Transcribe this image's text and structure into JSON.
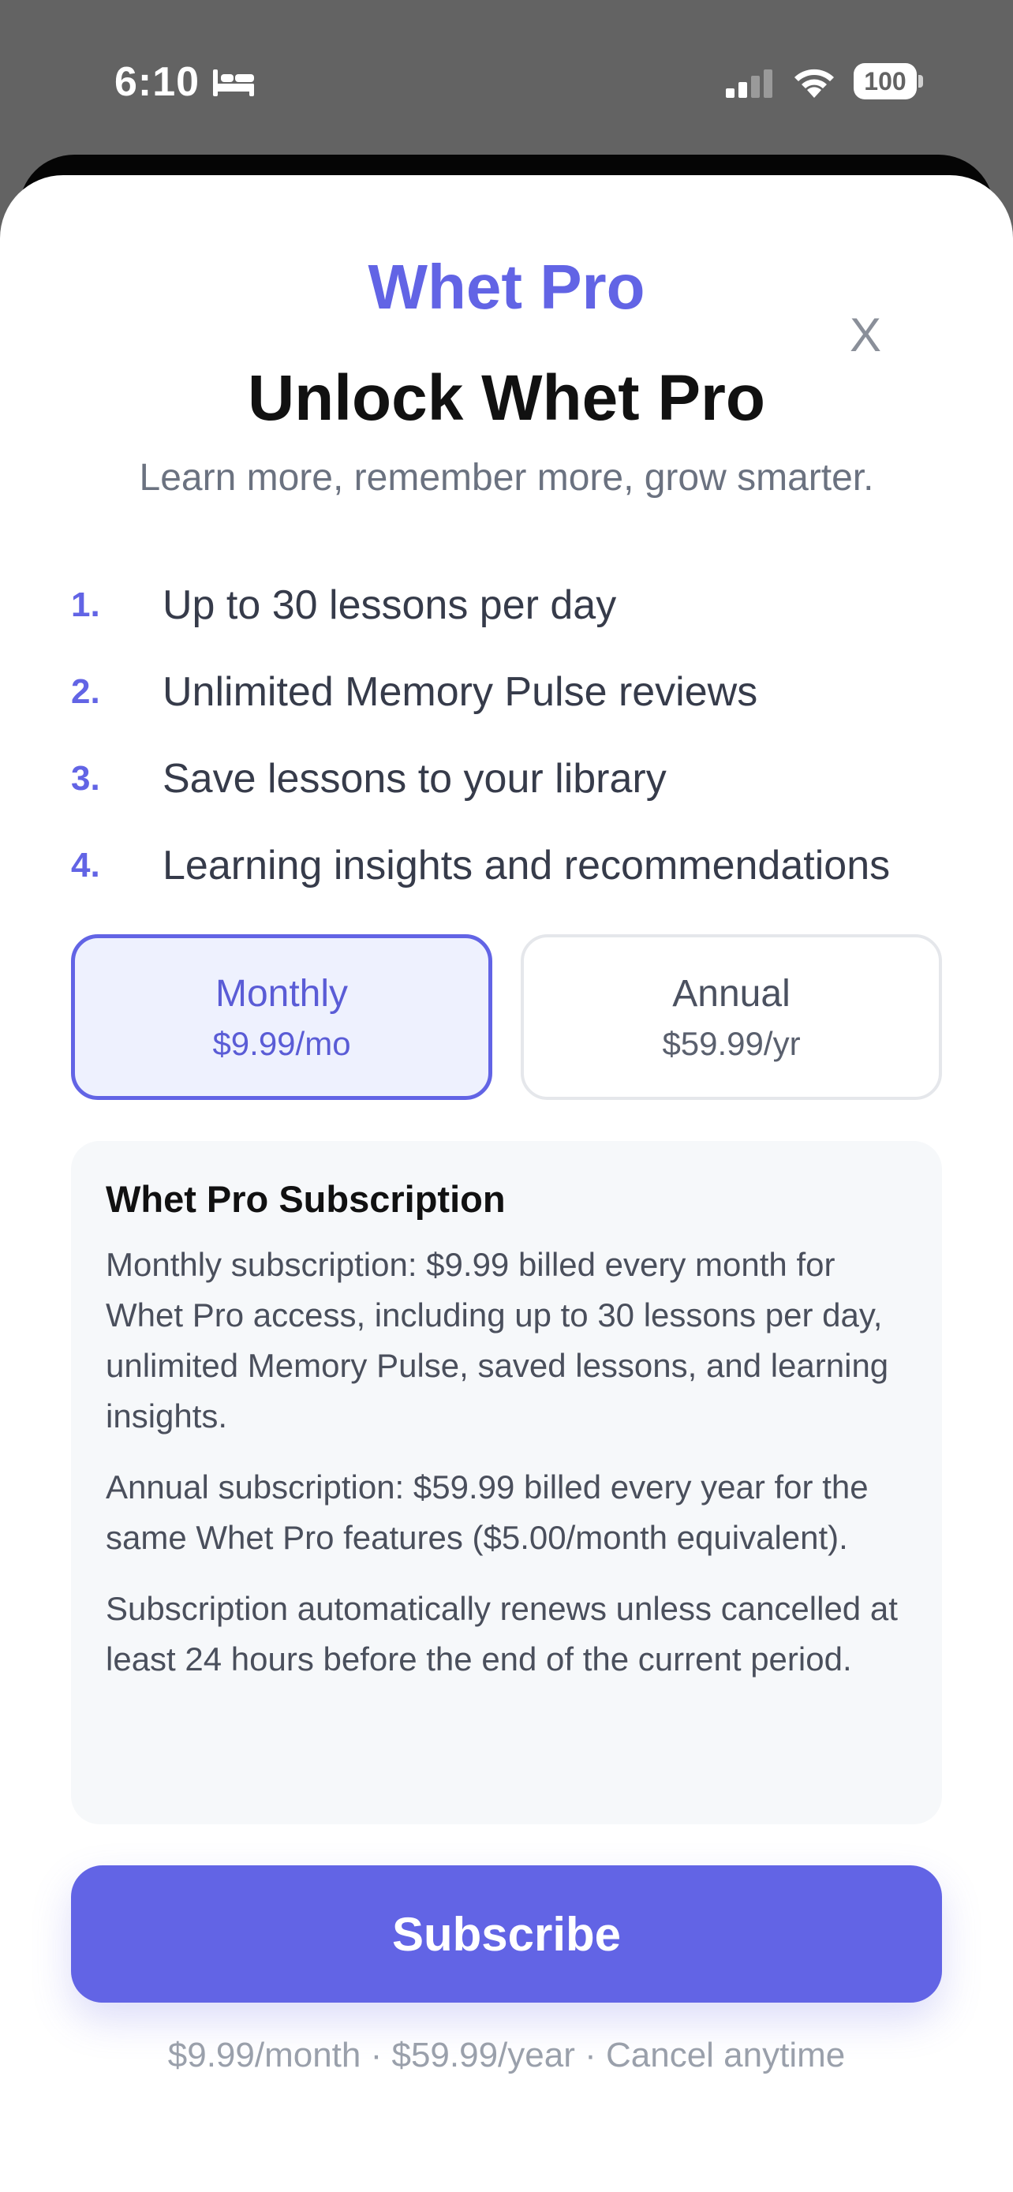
{
  "status_bar": {
    "time": "6:10",
    "battery": "100"
  },
  "paywall": {
    "brand": "Whet Pro",
    "close_label": "X",
    "title": "Unlock Whet Pro",
    "subtitle": "Learn more, remember more, grow smarter.",
    "features": [
      {
        "number": "1.",
        "text": "Up to 30 lessons per day"
      },
      {
        "number": "2.",
        "text": "Unlimited Memory Pulse reviews"
      },
      {
        "number": "3.",
        "text": "Save lessons to your library"
      },
      {
        "number": "4.",
        "text": "Learning insights and recommendations"
      }
    ],
    "plans": [
      {
        "name": "Monthly",
        "price": "$9.99/mo",
        "selected": true
      },
      {
        "name": "Annual",
        "price": "$59.99/yr",
        "selected": false
      }
    ],
    "details": {
      "title": "Whet Pro Subscription",
      "paragraphs": [
        "Monthly subscription: $9.99 billed every month for Whet Pro access, including up to 30 lessons per day, unlimited Memory Pulse, saved lessons, and learning insights.",
        "Annual subscription: $59.99 billed every year for the same Whet Pro features ($5.00/month equivalent).",
        "Subscription automatically renews unless cancelled at least 24 hours before the end of the current period."
      ]
    },
    "subscribe_label": "Subscribe",
    "footer": "$9.99/month · $59.99/year · Cancel anytime"
  },
  "colors": {
    "accent": "#6264e5",
    "status_bar_bg": "#636363"
  }
}
